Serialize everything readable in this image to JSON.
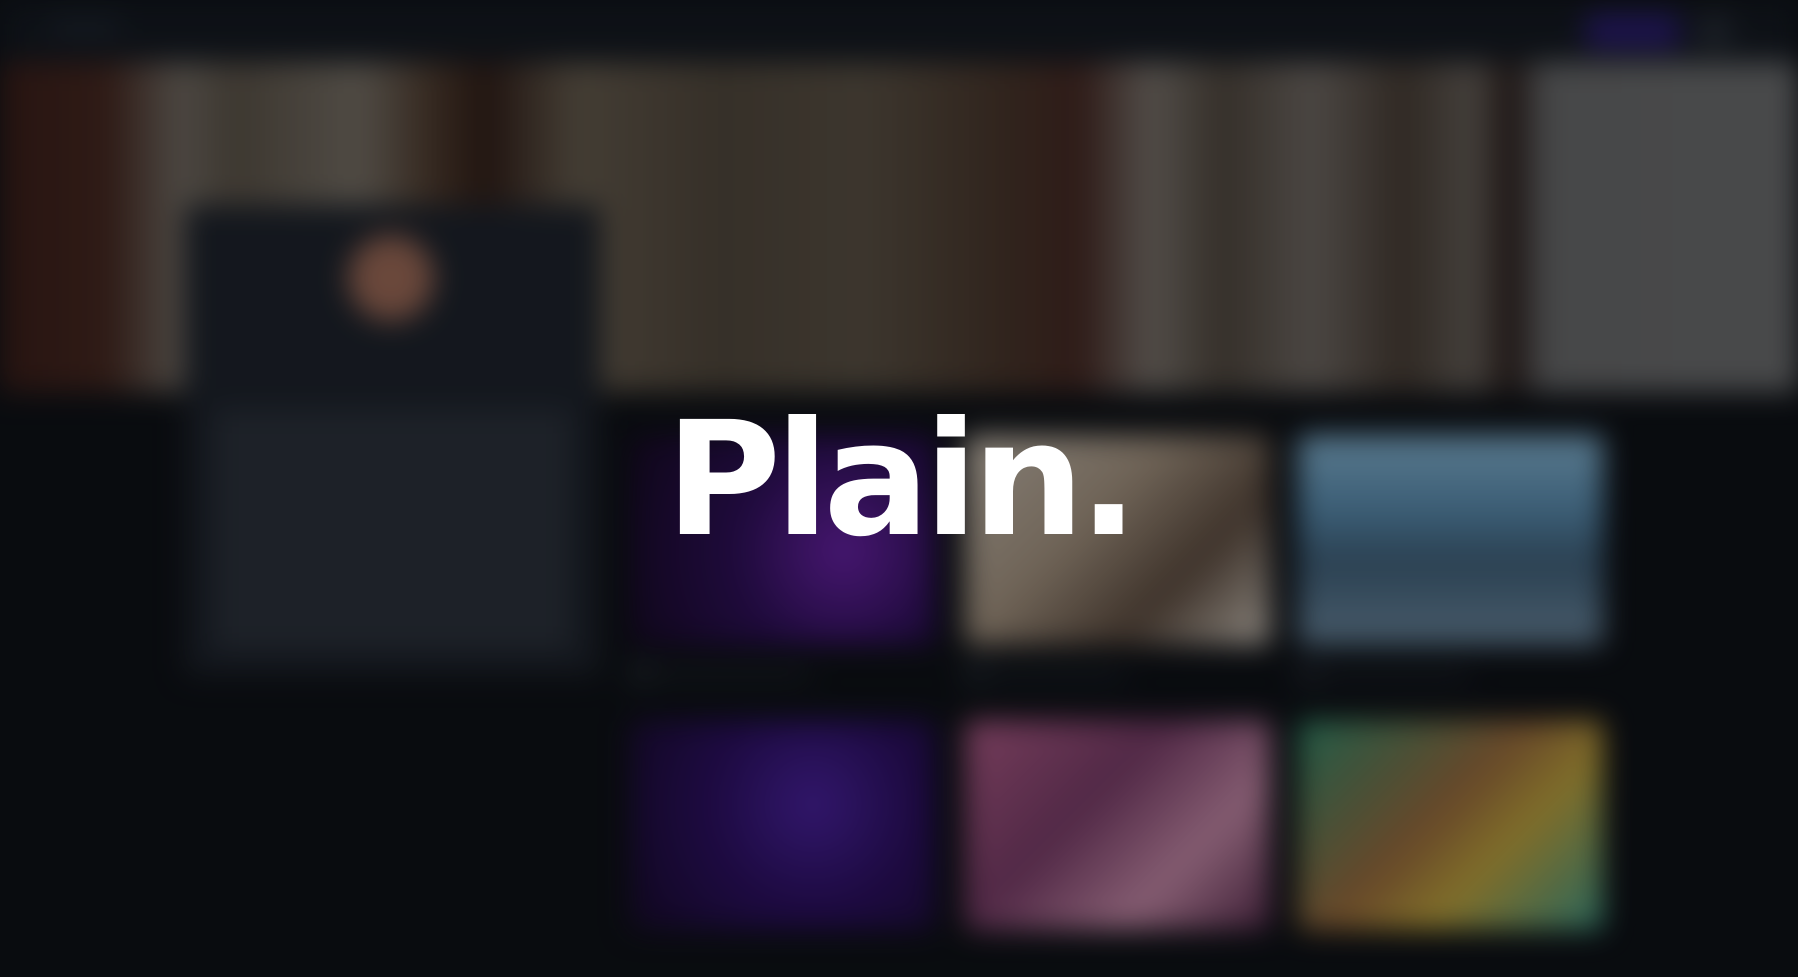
{
  "overlay": {
    "logo_text": "Plain."
  },
  "colors": {
    "background": "#0c0e12",
    "logo": "#ffffff",
    "accent_button": "#2a1a72"
  },
  "background_content": {
    "state": "blurred",
    "tiles": [
      "media-tile-1",
      "media-tile-2",
      "media-tile-3",
      "media-tile-4",
      "media-tile-5",
      "media-tile-6"
    ]
  }
}
